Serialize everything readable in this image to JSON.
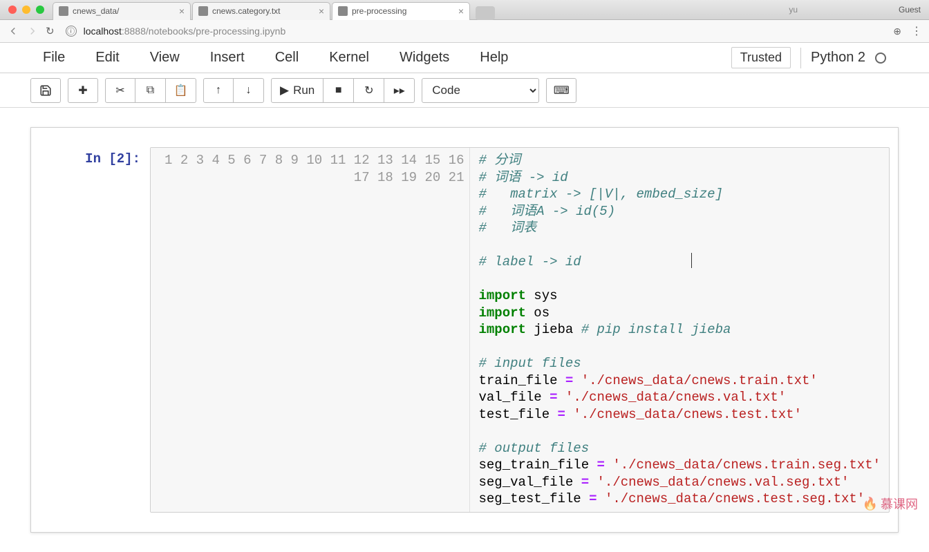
{
  "browser": {
    "tabs": [
      {
        "title": "cnews_data/",
        "active": false
      },
      {
        "title": "cnews.category.txt",
        "active": false
      },
      {
        "title": "pre-processing",
        "active": true
      }
    ],
    "url_host": "localhost",
    "url_port": ":8888",
    "url_path": "/notebooks/pre-processing.ipynb",
    "guest_label": "Guest",
    "user_label": "yu"
  },
  "menu": {
    "items": [
      "File",
      "Edit",
      "View",
      "Insert",
      "Cell",
      "Kernel",
      "Widgets",
      "Help"
    ],
    "trusted": "Trusted",
    "kernel": "Python 2"
  },
  "toolbar": {
    "run_label": "Run",
    "cell_type": "Code"
  },
  "cell": {
    "prompt": "In [2]:",
    "line_numbers": [
      "1",
      "2",
      "3",
      "4",
      "5",
      "6",
      "7",
      "8",
      "9",
      "10",
      "11",
      "12",
      "13",
      "14",
      "15",
      "16",
      "17",
      "18",
      "19",
      "20",
      "21"
    ],
    "code": {
      "l1": "# 分词",
      "l2": "# 词语 -> id",
      "l3": "#   matrix -> [|V|, embed_size]",
      "l4": "#   词语A -> id(5)",
      "l5": "#   词表",
      "l6": "",
      "l7": "# label -> id",
      "l8": "",
      "l9_kw": "import",
      "l9_v": " sys",
      "l10_kw": "import",
      "l10_v": " os",
      "l11_kw": "import",
      "l11_v": " jieba ",
      "l11_c": "# pip install jieba",
      "l12": "",
      "l13": "# input files",
      "l14_a": "train_file ",
      "l14_op": "=",
      "l14_b": " ",
      "l14_s": "'./cnews_data/cnews.train.txt'",
      "l15_a": "val_file ",
      "l15_op": "=",
      "l15_b": " ",
      "l15_s": "'./cnews_data/cnews.val.txt'",
      "l16_a": "test_file ",
      "l16_op": "=",
      "l16_b": " ",
      "l16_s": "'./cnews_data/cnews.test.txt'",
      "l17": "",
      "l18": "# output files",
      "l19_a": "seg_train_file ",
      "l19_op": "=",
      "l19_b": " ",
      "l19_s": "'./cnews_data/cnews.train.seg.txt'",
      "l20_a": "seg_val_file ",
      "l20_op": "=",
      "l20_b": " ",
      "l20_s": "'./cnews_data/cnews.val.seg.txt'",
      "l21_a": "seg_test_file ",
      "l21_op": "=",
      "l21_b": " ",
      "l21_s": "'./cnews_data/cnews.test.seg.txt'"
    }
  },
  "watermark": "慕课网"
}
